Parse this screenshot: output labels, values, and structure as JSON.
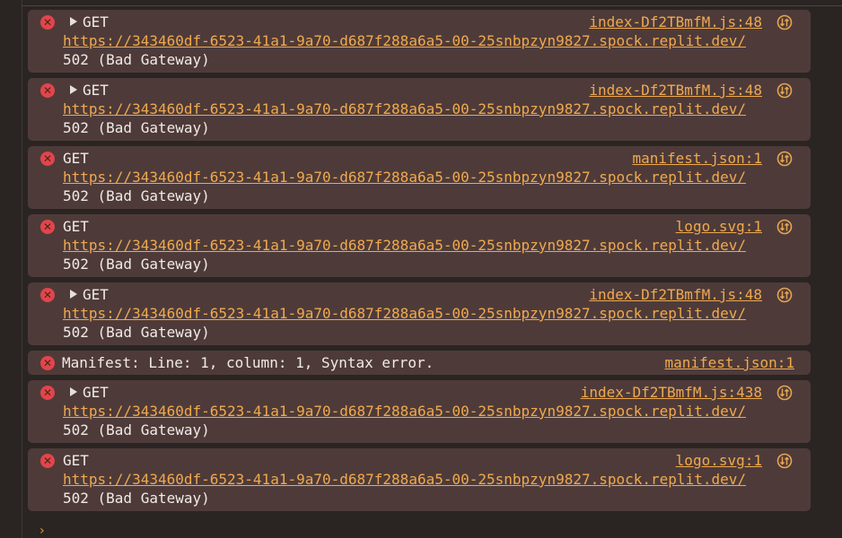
{
  "colors": {
    "background": "#2a2523",
    "message_background": "#4e3b39",
    "error_red": "#e2454a",
    "link_orange": "#f0a94f",
    "text": "#f0eae8"
  },
  "messages": [
    {
      "kind": "request",
      "expandable": true,
      "method": "GET",
      "source": "index-Df2TBmfM.js:48",
      "url": "https://343460df-6523-41a1-9a70-d687f288a6a5-00-25snbpzyn9827.spock.replit.dev/",
      "status": "502 (Bad Gateway)",
      "icon": "network-request-icon"
    },
    {
      "kind": "request",
      "expandable": true,
      "method": "GET",
      "source": "index-Df2TBmfM.js:48",
      "url": "https://343460df-6523-41a1-9a70-d687f288a6a5-00-25snbpzyn9827.spock.replit.dev/",
      "status": "502 (Bad Gateway)",
      "icon": "network-request-icon"
    },
    {
      "kind": "request",
      "expandable": false,
      "method": "GET",
      "source": "manifest.json:1",
      "url": "https://343460df-6523-41a1-9a70-d687f288a6a5-00-25snbpzyn9827.spock.replit.dev/",
      "status": "502 (Bad Gateway)",
      "icon": "network-request-icon"
    },
    {
      "kind": "request",
      "expandable": false,
      "method": "GET",
      "source": "logo.svg:1",
      "url": "https://343460df-6523-41a1-9a70-d687f288a6a5-00-25snbpzyn9827.spock.replit.dev/",
      "status": "502 (Bad Gateway)",
      "icon": "network-request-icon"
    },
    {
      "kind": "request",
      "expandable": true,
      "method": "GET",
      "source": "index-Df2TBmfM.js:48",
      "url": "https://343460df-6523-41a1-9a70-d687f288a6a5-00-25snbpzyn9827.spock.replit.dev/",
      "status": "502 (Bad Gateway)",
      "icon": "network-request-icon"
    },
    {
      "kind": "error",
      "text": "Manifest: Line: 1, column: 1, Syntax error.",
      "source": "manifest.json:1"
    },
    {
      "kind": "request",
      "expandable": true,
      "method": "GET",
      "source": "index-Df2TBmfM.js:438",
      "url": "https://343460df-6523-41a1-9a70-d687f288a6a5-00-25snbpzyn9827.spock.replit.dev/",
      "status": "502 (Bad Gateway)",
      "icon": "network-request-icon"
    },
    {
      "kind": "request",
      "expandable": false,
      "method": "GET",
      "source": "logo.svg:1",
      "url": "https://343460df-6523-41a1-9a70-d687f288a6a5-00-25snbpzyn9827.spock.replit.dev/",
      "status": "502 (Bad Gateway)",
      "icon": "network-request-icon"
    }
  ],
  "prompt": {
    "symbol": "›"
  }
}
